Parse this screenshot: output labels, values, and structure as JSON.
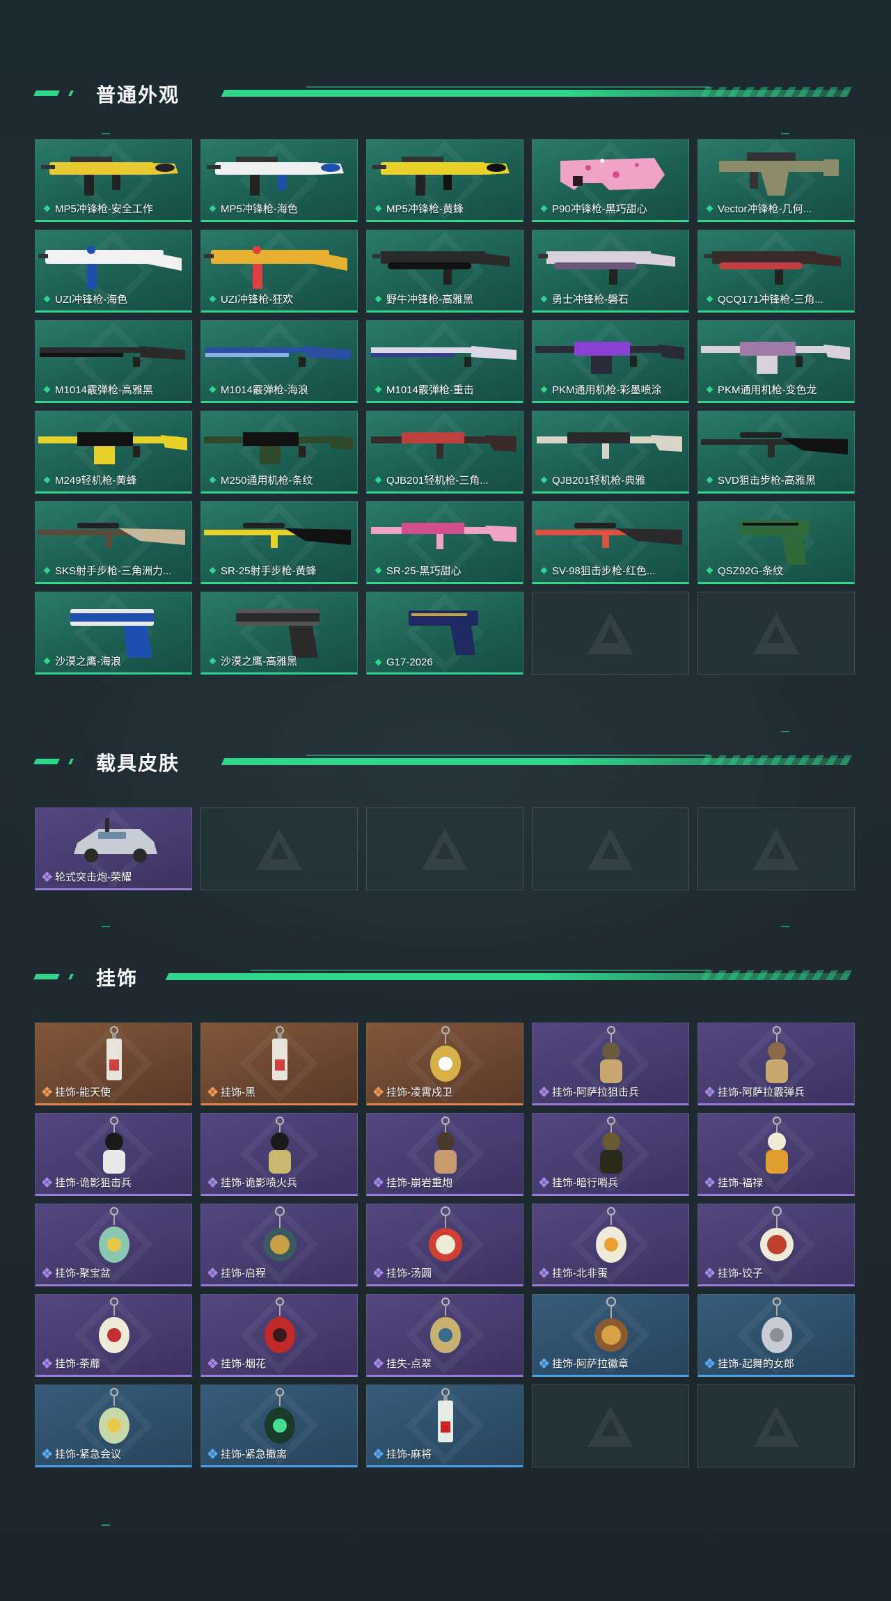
{
  "sections": {
    "weapons": {
      "title": "普通外观",
      "items": [
        {
          "label": "MP5冲锋枪-安全工作",
          "rarity": "green",
          "art": "smg",
          "c1": "#e8c930",
          "c2": "#222"
        },
        {
          "label": "MP5冲锋枪-海色",
          "rarity": "green",
          "art": "smg",
          "c1": "#f0f0f0",
          "c2": "#1e4fb0"
        },
        {
          "label": "MP5冲锋枪-黄蜂",
          "rarity": "green",
          "art": "smg",
          "c1": "#e8d22a",
          "c2": "#111"
        },
        {
          "label": "P90冲锋枪-黑巧甜心",
          "rarity": "green",
          "art": "p90",
          "c1": "#f0a2c8",
          "c2": "#d44e8e"
        },
        {
          "label": "Vector冲锋枪-几何...",
          "rarity": "green",
          "art": "vector",
          "c1": "#8c8c6a",
          "c2": "#333"
        },
        {
          "label": "UZI冲锋枪-海色",
          "rarity": "green",
          "art": "uzi",
          "c1": "#f2f2f2",
          "c2": "#1e4fb0"
        },
        {
          "label": "UZI冲锋枪-狂欢",
          "rarity": "green",
          "art": "uzi",
          "c1": "#e8b030",
          "c2": "#e04040"
        },
        {
          "label": "野牛冲锋枪-高雅黑",
          "rarity": "green",
          "art": "bizon",
          "c1": "#2a2a2a",
          "c2": "#111"
        },
        {
          "label": "勇士冲锋枪-磐石",
          "rarity": "green",
          "art": "bizon",
          "c1": "#d8d0dc",
          "c2": "#6a5a78"
        },
        {
          "label": "QCQ171冲锋枪-三角...",
          "rarity": "green",
          "art": "bizon",
          "c1": "#3a2a2a",
          "c2": "#c04040"
        },
        {
          "label": "M1014霰弹枪-高雅黑",
          "rarity": "green",
          "art": "shotgun",
          "c1": "#2a2a2a",
          "c2": "#111"
        },
        {
          "label": "M1014霰弹枪-海浪",
          "rarity": "green",
          "art": "shotgun",
          "c1": "#2a4ea0",
          "c2": "#8ab0e8"
        },
        {
          "label": "M1014霰弹枪-重击",
          "rarity": "green",
          "art": "shotgun",
          "c1": "#dcd8e8",
          "c2": "#3a3a8a"
        },
        {
          "label": "PKM通用机枪-彩墨喷涂",
          "rarity": "green",
          "art": "lmg",
          "c1": "#2a2a3a",
          "c2": "#8a40d0"
        },
        {
          "label": "PKM通用机枪-变色龙",
          "rarity": "green",
          "art": "lmg",
          "c1": "#d8d0dc",
          "c2": "#a07aa8"
        },
        {
          "label": "M249轻机枪-黄蜂",
          "rarity": "green",
          "art": "lmg",
          "c1": "#e8d22a",
          "c2": "#111"
        },
        {
          "label": "M250通用机枪-条纹",
          "rarity": "green",
          "art": "lmg",
          "c1": "#2e4a2a",
          "c2": "#111"
        },
        {
          "label": "QJB201轻机枪-三角...",
          "rarity": "green",
          "art": "rifle",
          "c1": "#3a2a2a",
          "c2": "#c04040"
        },
        {
          "label": "QJB201轻机枪-典雅",
          "rarity": "green",
          "art": "rifle",
          "c1": "#d8d4c8",
          "c2": "#2a2a2a"
        },
        {
          "label": "SVD狙击步枪-高雅黑",
          "rarity": "green",
          "art": "sniper",
          "c1": "#2a2a2a",
          "c2": "#111"
        },
        {
          "label": "SKS射手步枪-三角洲力...",
          "rarity": "green",
          "art": "sniper",
          "c1": "#5a4a3a",
          "c2": "#c8b89a"
        },
        {
          "label": "SR-25射手步枪-黄蜂",
          "rarity": "green",
          "art": "sniper",
          "c1": "#e8d22a",
          "c2": "#111"
        },
        {
          "label": "SR-25-黑巧甜心",
          "rarity": "green",
          "art": "rifle",
          "c1": "#f0a2c8",
          "c2": "#d44e8e"
        },
        {
          "label": "SV-98狙击步枪-红色...",
          "rarity": "green",
          "art": "sniper",
          "c1": "#e05040",
          "c2": "#2a2a2a"
        },
        {
          "label": "QSZ92G-条纹",
          "rarity": "green",
          "art": "pistol",
          "c1": "#2e6a3a",
          "c2": "#111"
        },
        {
          "label": "沙漠之鹰-海浪",
          "rarity": "green",
          "art": "deagle",
          "c1": "#1e4fb0",
          "c2": "#e8e8e8"
        },
        {
          "label": "沙漠之鹰-高雅黑",
          "rarity": "green",
          "art": "deagle",
          "c1": "#2a2a2a",
          "c2": "#555"
        },
        {
          "label": "G17-2026",
          "rarity": "green",
          "art": "pistol",
          "c1": "#1e2a60",
          "c2": "#c8a040"
        },
        {
          "label": "",
          "rarity": "empty"
        },
        {
          "label": "",
          "rarity": "empty"
        }
      ]
    },
    "vehicles": {
      "title": "载具皮肤",
      "items": [
        {
          "label": "轮式突击炮-荣耀",
          "rarity": "purple",
          "art": "vehicle",
          "c1": "#c8ccd4",
          "c2": "#2a2a2a"
        },
        {
          "label": "",
          "rarity": "empty"
        },
        {
          "label": "",
          "rarity": "empty"
        },
        {
          "label": "",
          "rarity": "empty"
        },
        {
          "label": "",
          "rarity": "empty"
        }
      ]
    },
    "charms": {
      "title": "挂饰",
      "items": [
        {
          "label": "挂饰-能天使",
          "rarity": "orange",
          "art": "charm-tag",
          "c1": "#e8e4dc",
          "c2": "#d04040"
        },
        {
          "label": "挂饰-黑",
          "rarity": "orange",
          "art": "charm-tag",
          "c1": "#e8e4dc",
          "c2": "#d04040"
        },
        {
          "label": "挂饰-凌霄戍卫",
          "rarity": "orange",
          "art": "charm",
          "c1": "#d8b048",
          "c2": "#ffffff"
        },
        {
          "label": "挂饰-阿萨拉狙击兵",
          "rarity": "purple",
          "art": "charm-fig",
          "c1": "#6a5a40",
          "c2": "#c8a870"
        },
        {
          "label": "挂饰-阿萨拉霰弹兵",
          "rarity": "purple",
          "art": "charm-fig",
          "c1": "#8a6a4a",
          "c2": "#c8a870"
        },
        {
          "label": "挂饰-诡影狙击兵",
          "rarity": "purple",
          "art": "charm-fig",
          "c1": "#1a1a1a",
          "c2": "#e8e8e8"
        },
        {
          "label": "挂饰-诡影喷火兵",
          "rarity": "purple",
          "art": "charm-fig",
          "c1": "#1a1a1a",
          "c2": "#c8b870"
        },
        {
          "label": "挂饰-崩岩重炮",
          "rarity": "purple",
          "art": "charm-fig",
          "c1": "#4a3a2a",
          "c2": "#c89a70"
        },
        {
          "label": "挂饰-暗行哨兵",
          "rarity": "purple",
          "art": "charm-fig",
          "c1": "#6a5a30",
          "c2": "#2a2a1a"
        },
        {
          "label": "挂饰-福禄",
          "rarity": "purple",
          "art": "charm-fig",
          "c1": "#f0ead8",
          "c2": "#e0a030"
        },
        {
          "label": "挂饰-聚宝盆",
          "rarity": "purple",
          "art": "charm",
          "c1": "#8ac8b0",
          "c2": "#e8c848"
        },
        {
          "label": "挂饰-启程",
          "rarity": "purple",
          "art": "charm-ring",
          "c1": "#3a5a60",
          "c2": "#c8a048"
        },
        {
          "label": "挂饰-汤圆",
          "rarity": "purple",
          "art": "charm-ring",
          "c1": "#d04030",
          "c2": "#f0ead8"
        },
        {
          "label": "挂饰-北非蛋",
          "rarity": "purple",
          "art": "charm",
          "c1": "#f0ead8",
          "c2": "#e8a030"
        },
        {
          "label": "挂饰-饺子",
          "rarity": "purple",
          "art": "charm-ring",
          "c1": "#f0ead8",
          "c2": "#c04030"
        },
        {
          "label": "挂饰-荼蘼",
          "rarity": "purple",
          "art": "charm",
          "c1": "#f0ead8",
          "c2": "#c03030"
        },
        {
          "label": "挂饰-烟花",
          "rarity": "purple",
          "art": "charm",
          "c1": "#c02a2a",
          "c2": "#3a1a1a"
        },
        {
          "label": "挂失-点翠",
          "rarity": "purple",
          "art": "charm",
          "c1": "#c8b070",
          "c2": "#3a6a8a"
        },
        {
          "label": "挂饰-阿萨拉徽章",
          "rarity": "blue",
          "art": "charm-ring",
          "c1": "#8a5a30",
          "c2": "#d8a048"
        },
        {
          "label": "挂饰-起舞的女郎",
          "rarity": "blue",
          "art": "charm",
          "c1": "#c8ccd4",
          "c2": "#8a8e96"
        },
        {
          "label": "挂饰-紧急会议",
          "rarity": "blue",
          "art": "charm",
          "c1": "#c8d8a8",
          "c2": "#e8c848"
        },
        {
          "label": "挂饰-紧急撤离",
          "rarity": "blue",
          "art": "charm",
          "c1": "#1a3a2a",
          "c2": "#40e090"
        },
        {
          "label": "挂饰-麻将",
          "rarity": "blue",
          "art": "charm-tag",
          "c1": "#e8ece8",
          "c2": "#d02020"
        },
        {
          "label": "",
          "rarity": "empty"
        },
        {
          "label": "",
          "rarity": "empty"
        }
      ]
    }
  },
  "colors": {
    "accent": "#2fd68b",
    "green_card": "#1d5f53",
    "purple_card": "#453b6d",
    "orange_card": "#6a4530",
    "blue_card": "#2d4e69",
    "empty_card": "#26363a"
  }
}
